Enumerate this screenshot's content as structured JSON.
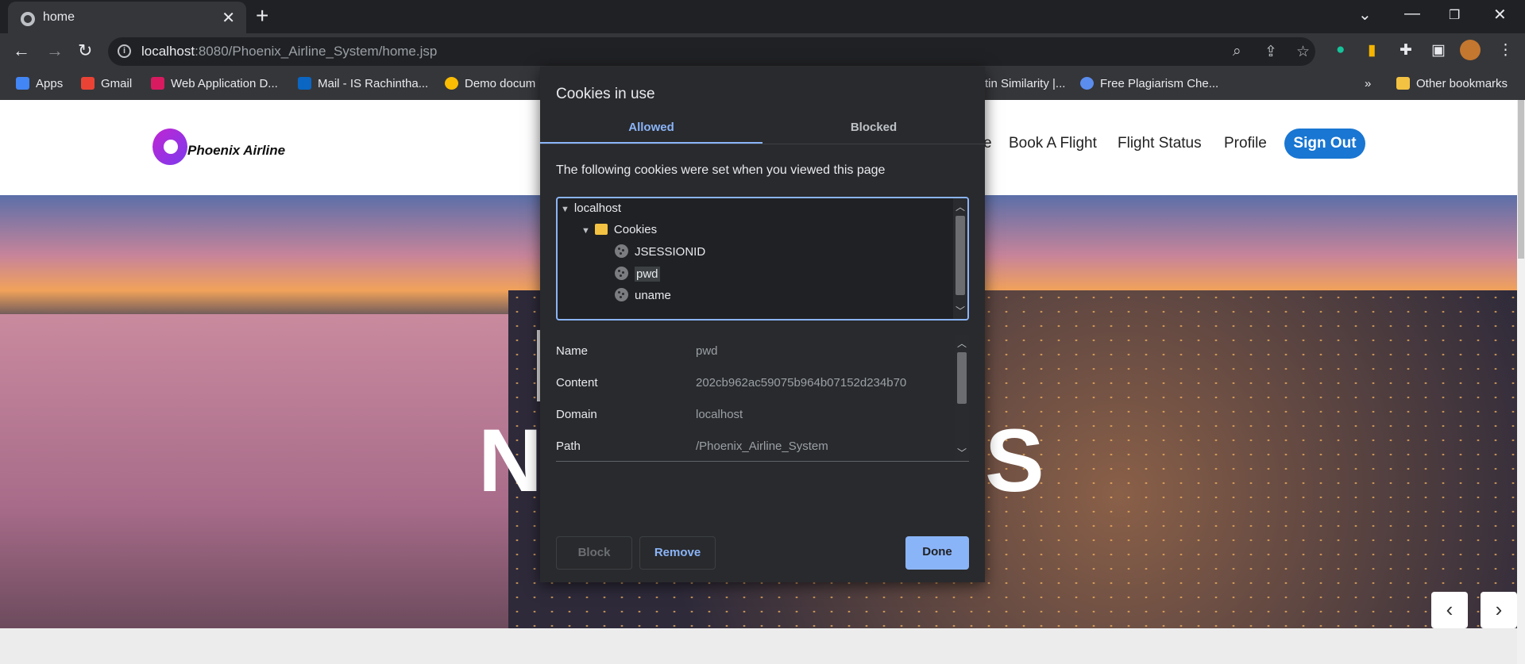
{
  "browser": {
    "tab_title": "home",
    "url_host": "localhost",
    "url_rest": ":8080/Phoenix_Airline_System/home.jsp",
    "bookmarks": [
      {
        "label": "Apps",
        "color": "#4285f4"
      },
      {
        "label": "Gmail",
        "color": "#ea4335"
      },
      {
        "label": "Web Application D...",
        "color": "#d81b60"
      },
      {
        "label": "Mail - IS Rachintha...",
        "color": "#0a66c2"
      },
      {
        "label": "Demo docum",
        "color": "#fbbc04"
      },
      {
        "label": "tin Similarity |...",
        "color": "#35363a"
      },
      {
        "label": "Free Plagiarism Che...",
        "color": "#5b8def"
      }
    ],
    "more_bookmarks": "»",
    "other_bookmarks": "Other bookmarks"
  },
  "site": {
    "logo_text": "Phoenix Airline",
    "nav": [
      "e",
      "Book A Flight",
      "Flight Status",
      "Profile"
    ],
    "signout_label": "Sign Out",
    "hero_left": "N",
    "hero_right": "S",
    "carousel_prev": "‹",
    "carousel_next": "›"
  },
  "dialog": {
    "title": "Cookies in use",
    "tabs": {
      "allowed": "Allowed",
      "blocked": "Blocked"
    },
    "description": "The following cookies were set when you viewed this page",
    "tree": {
      "site": "localhost",
      "folder": "Cookies",
      "cookies": [
        "JSESSIONID",
        "pwd",
        "uname"
      ],
      "selected": "pwd"
    },
    "details": [
      {
        "key": "Name",
        "value": "pwd"
      },
      {
        "key": "Content",
        "value": "202cb962ac59075b964b07152d234b70"
      },
      {
        "key": "Domain",
        "value": "localhost"
      },
      {
        "key": "Path",
        "value": "/Phoenix_Airline_System"
      }
    ],
    "buttons": {
      "block": "Block",
      "remove": "Remove",
      "done": "Done"
    }
  }
}
